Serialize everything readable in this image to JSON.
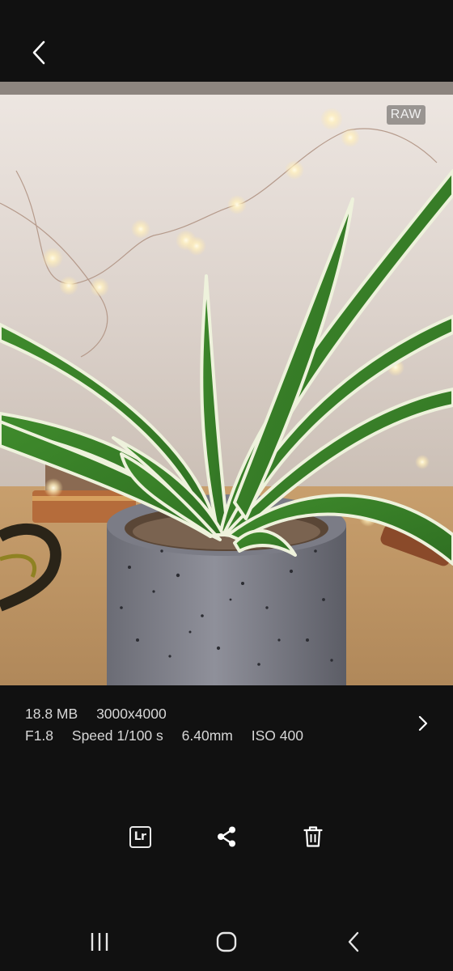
{
  "header": {
    "back_icon": "chevron-left-icon"
  },
  "photo": {
    "badge": "RAW",
    "subject": "potted spider plant"
  },
  "info": {
    "file_size": "18.8 MB",
    "resolution": "3000x4000",
    "aperture": "F1.8",
    "speed": "Speed 1/100 s",
    "focal_length": "6.40mm",
    "iso": "ISO 400",
    "details_icon": "chevron-right-icon"
  },
  "actions": [
    {
      "name": "lightroom",
      "icon": "lightroom-icon",
      "label": "Lr"
    },
    {
      "name": "share",
      "icon": "share-icon"
    },
    {
      "name": "delete",
      "icon": "trash-icon"
    }
  ],
  "nav_bar": {
    "icons": [
      "recent-apps-icon",
      "home-icon",
      "back-icon"
    ]
  },
  "colors": {
    "background": "#111111",
    "text": "#d7d7d7",
    "icon": "#ffffff"
  }
}
